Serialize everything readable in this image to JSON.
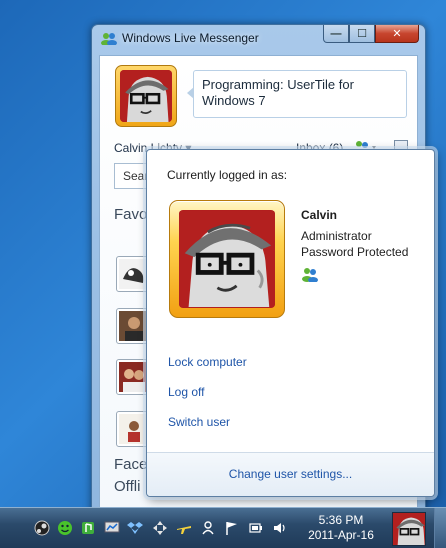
{
  "window": {
    "title": "Windows Live Messenger",
    "buttons": {
      "minimize": "—",
      "maximize": "☐",
      "close": "✕"
    }
  },
  "messenger": {
    "status_message": "Programming: UserTile for Windows 7",
    "user_name": "Calvin Lichty ▾",
    "inbox": "Inbox (6)",
    "search_partial": "Sear",
    "favorites_partial": "Favo",
    "bottom_heading_1": "Face",
    "bottom_heading_2": "Offli"
  },
  "popup": {
    "heading": "Currently logged in as:",
    "name": "Calvin",
    "role": "Administrator",
    "password_status": "Password Protected",
    "links": {
      "lock": "Lock computer",
      "logoff": "Log off",
      "switch": "Switch user",
      "settings": "Change user settings..."
    }
  },
  "taskbar": {
    "time": "5:36 PM",
    "date": "2011-Apr-16",
    "tray_icons": [
      "steam-icon",
      "smiley-icon",
      "media-icon",
      "network-monitor-icon",
      "dropbox-icon",
      "arrows-icon",
      "plane-icon",
      "user-icon",
      "flag-icon",
      "battery-icon",
      "volume-icon"
    ]
  },
  "colors": {
    "link": "#1f55a8",
    "tile_gold": "#f2a012",
    "taskbar": "#2b4a6b",
    "desktop": "#2f86d8"
  }
}
